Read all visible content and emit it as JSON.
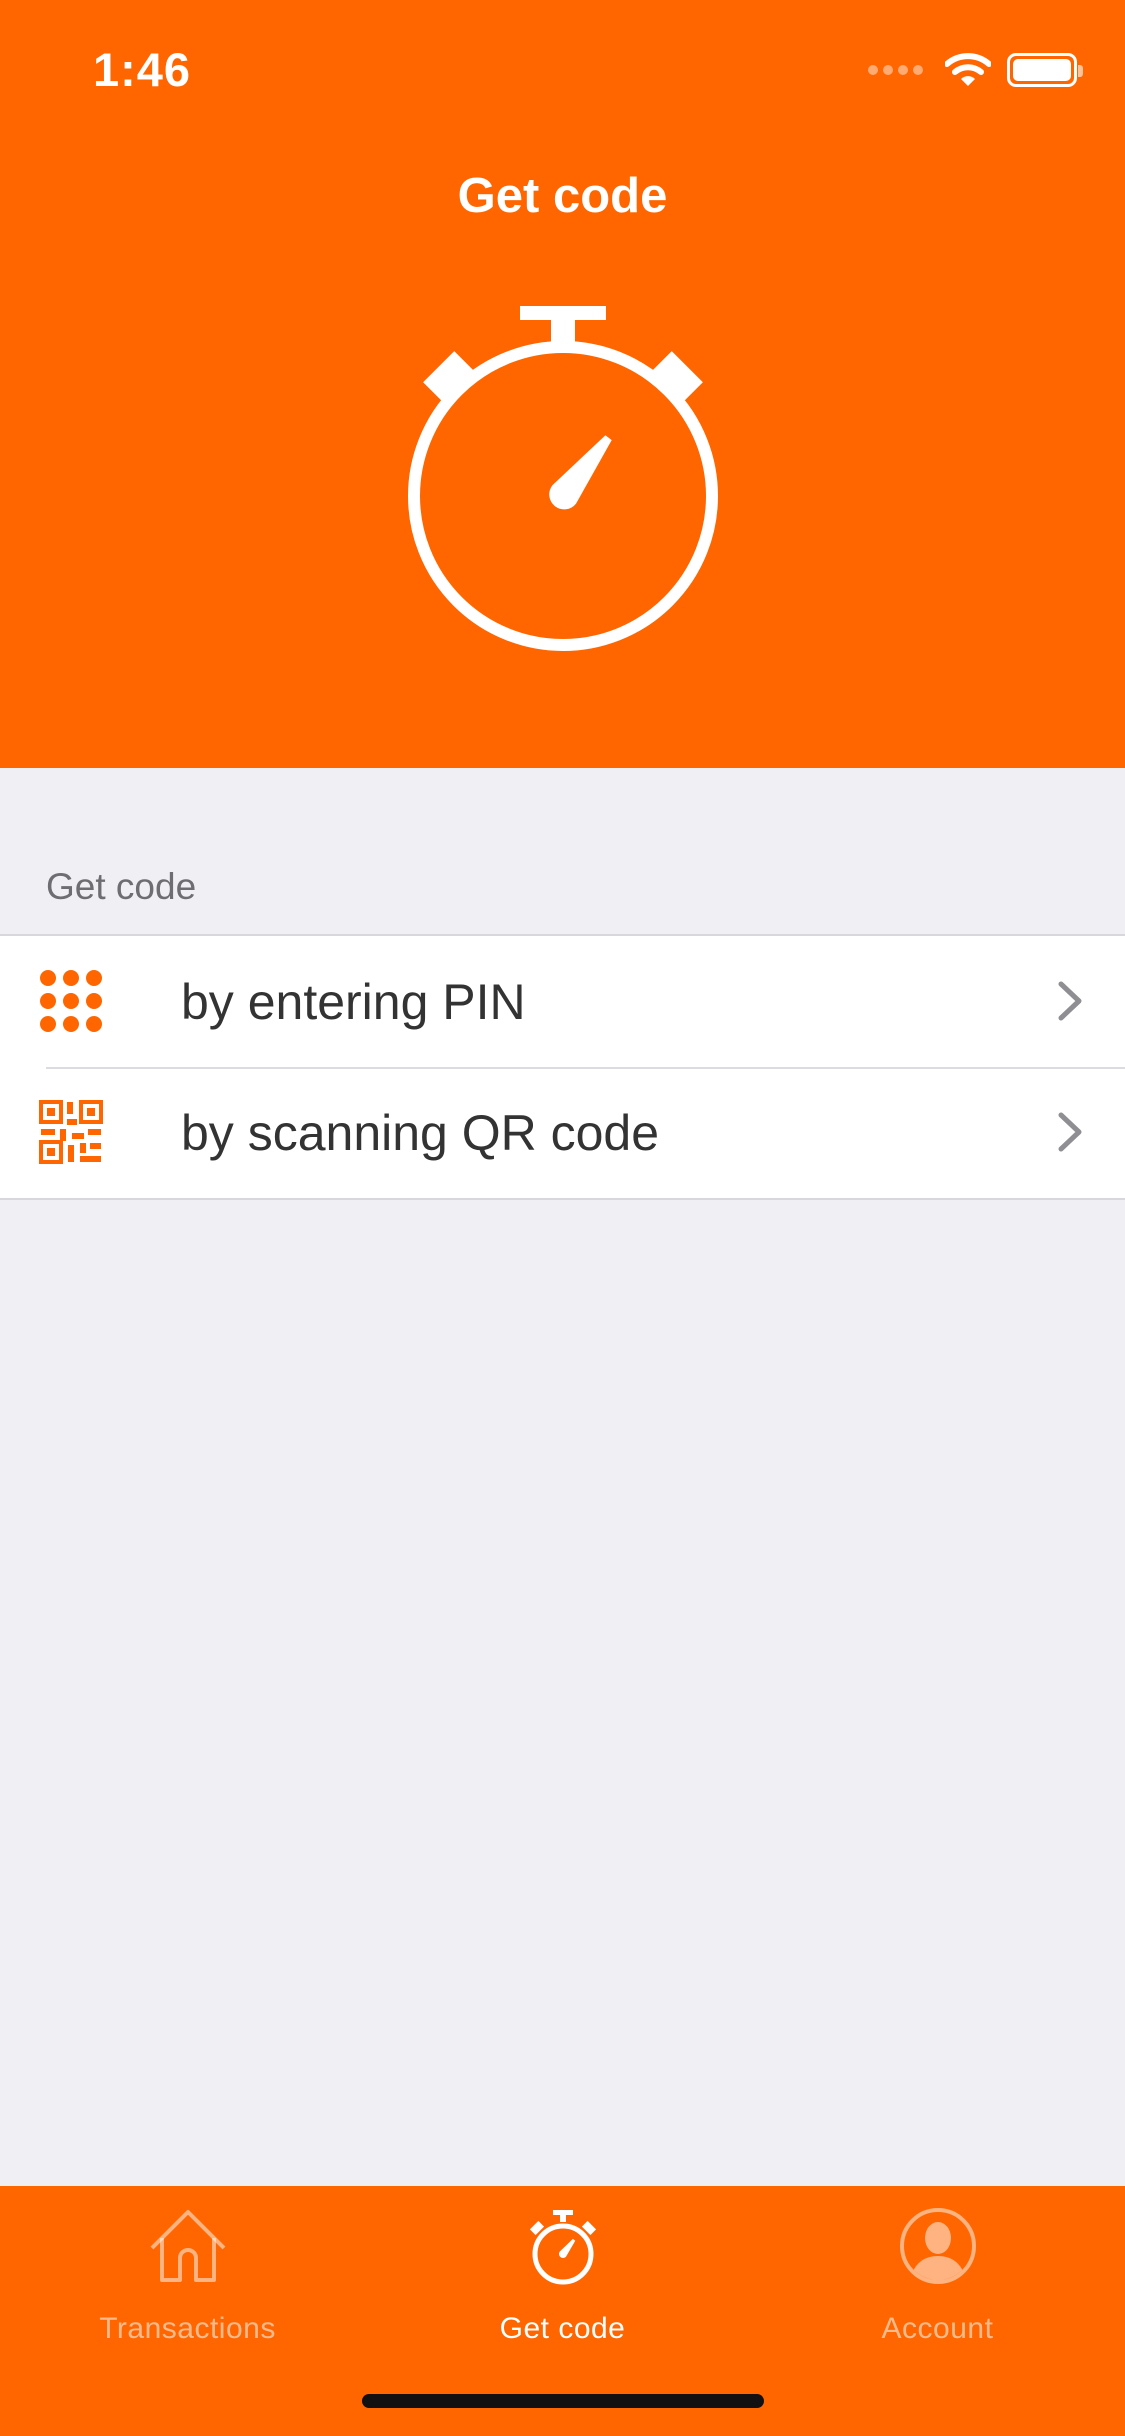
{
  "status_bar": {
    "time": "1:46"
  },
  "header": {
    "title": "Get code",
    "hero_icon": "stopwatch-icon"
  },
  "section": {
    "title": "Get code",
    "items": [
      {
        "label": "by entering PIN",
        "icon": "keypad-icon"
      },
      {
        "label": "by scanning QR code",
        "icon": "qr-code-icon"
      }
    ]
  },
  "tabbar": {
    "tabs": [
      {
        "label": "Transactions",
        "icon": "home-icon",
        "active": false
      },
      {
        "label": "Get code",
        "icon": "stopwatch-icon",
        "active": true
      },
      {
        "label": "Account",
        "icon": "user-icon",
        "active": false
      }
    ]
  },
  "colors": {
    "brand": "#ff6600",
    "background": "#efeff4",
    "text": "#333333"
  }
}
